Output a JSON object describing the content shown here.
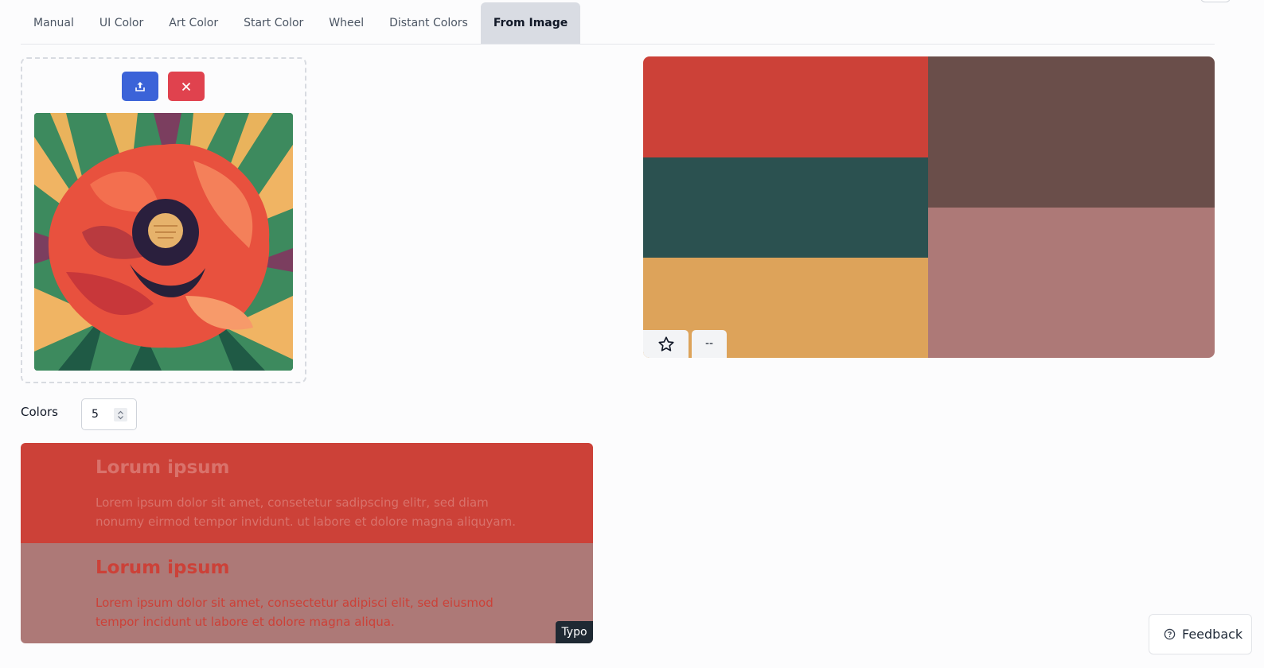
{
  "tabs": [
    {
      "label": "Manual"
    },
    {
      "label": "UI Color"
    },
    {
      "label": "Art Color"
    },
    {
      "label": "Start Color"
    },
    {
      "label": "Wheel"
    },
    {
      "label": "Distant Colors"
    },
    {
      "label": "From Image",
      "active": true
    }
  ],
  "upload": {
    "upload_icon": "upload-icon",
    "remove_icon": "close-icon",
    "image_subject": "poppy-illustration"
  },
  "colors_control": {
    "label": "Colors",
    "value": "5"
  },
  "palette": {
    "colors": [
      "#cc4138",
      "#2b5150",
      "#dda35a",
      "#6a4e4a",
      "#ad7977"
    ],
    "favorite_icon": "star-icon",
    "secondary_label": "--"
  },
  "preview": [
    {
      "title": "Lorum ipsum",
      "text": "Lorem ipsum dolor sit amet, consetetur sadipscing elitr, sed diam nonumy eirmod tempor invidunt. ut labore et dolore magna aliquyam.",
      "bg": "#cc4138",
      "fg": "#d9726b"
    },
    {
      "title": "Lorum ipsum",
      "text": "Lorem ipsum dolor sit amet, consectetur adipisci elit, sed eiusmod tempor incidunt ut labore et dolore magna aliqua.",
      "bg": "#ad7977",
      "fg": "#cc4138"
    }
  ],
  "typo_badge": "Typo",
  "feedback": {
    "label": "Feedback",
    "icon": "help-circle-icon"
  }
}
